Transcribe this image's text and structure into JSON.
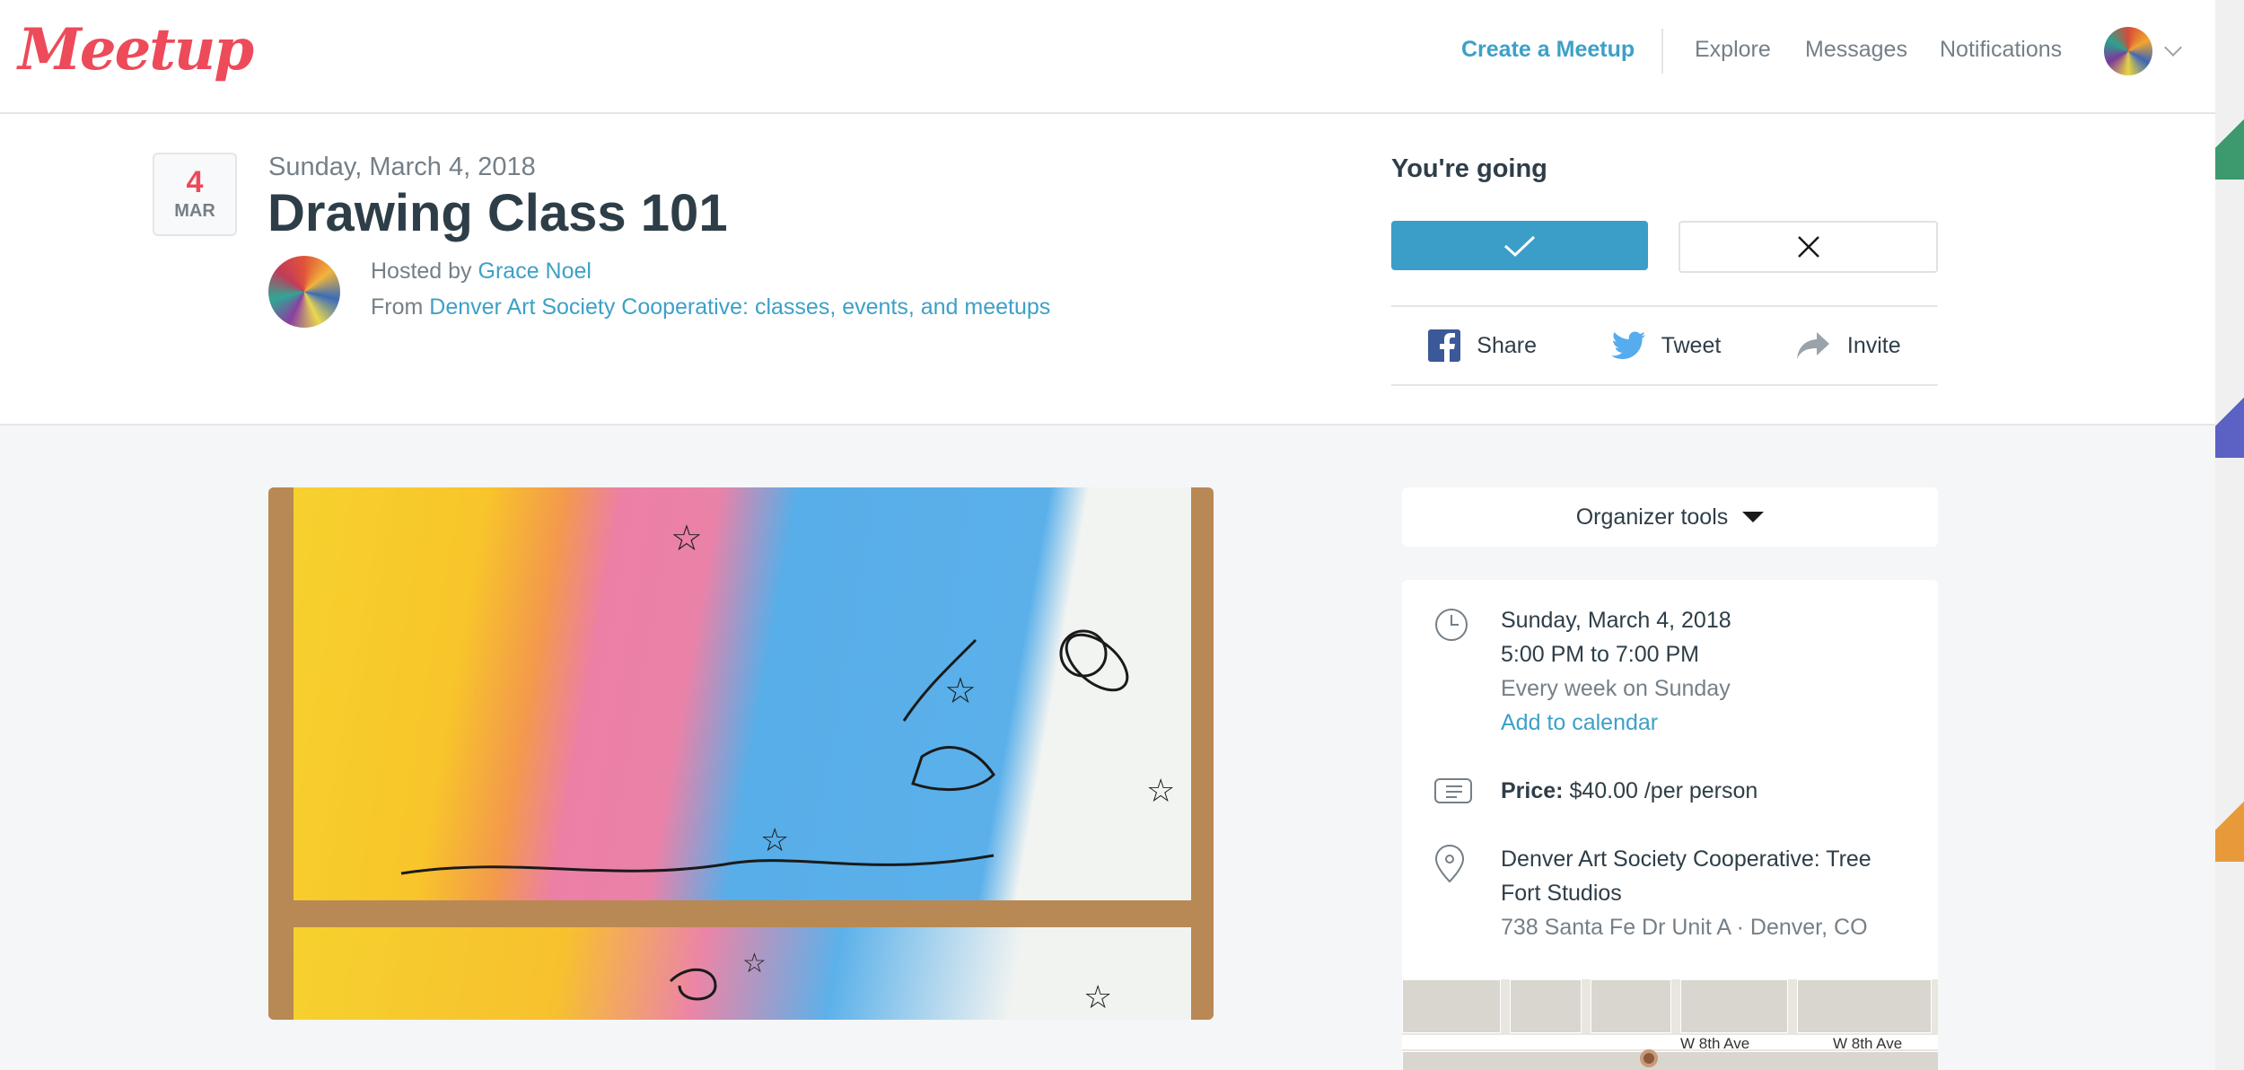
{
  "topbar": {
    "logo": "Meetup",
    "create": "Create a Meetup",
    "explore": "Explore",
    "messages": "Messages",
    "notifications": "Notifications",
    "avatar_icon": "user-avatar"
  },
  "event": {
    "badge_day": "4",
    "badge_month": "MAR",
    "date_line": "Sunday, March 4, 2018",
    "title": "Drawing Class 101",
    "hosted_by_prefix": "Hosted by",
    "host_name": "Grace Noel",
    "from_prefix": "From",
    "group_name": "Denver Art Society Cooperative: classes, events, and meetups"
  },
  "rsvp": {
    "status": "You're going",
    "yes_icon": "checkmark-icon",
    "no_icon": "close-icon",
    "share": "Share",
    "tweet": "Tweet",
    "invite": "Invite"
  },
  "sidebar": {
    "organizer_tools": "Organizer tools",
    "date": "Sunday, March 4, 2018",
    "time": "5:00 PM to 7:00 PM",
    "recurrence": "Every week on Sunday",
    "add_to_calendar": "Add to calendar",
    "price_label": "Price:",
    "price_value": "$40.00 /per person",
    "venue_name_1": "Denver Art Society Cooperative: Tree",
    "venue_name_2": "Fort Studios",
    "address": "738 Santa Fe Dr Unit A · Denver, CO",
    "map_road_1": "W 8th Ave",
    "map_road_2": "W 8th Ave"
  },
  "colors": {
    "brand": "#ed4a5a",
    "link": "#3da0c7",
    "rsvp_yes": "#3a9ec8"
  }
}
